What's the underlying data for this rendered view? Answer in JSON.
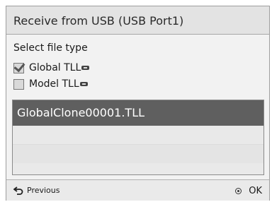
{
  "dialog": {
    "title": "Receive from USB (USB Port1)",
    "section_label": "Select file type"
  },
  "options": [
    {
      "label": "Global TLL",
      "checked": true,
      "icon": "usb-icon"
    },
    {
      "label": "Model TLL",
      "checked": false,
      "icon": "usb-icon"
    }
  ],
  "filelist": {
    "items": [
      "GlobalClone00001.TLL",
      "",
      "",
      ""
    ],
    "selected_index": 0
  },
  "footer": {
    "previous_label": "Previous",
    "previous_icon": "back-arrow-icon",
    "ok_label": "OK",
    "ok_icon": "ok-button-icon"
  },
  "colors": {
    "selected_row": "#5f5f5f",
    "titlebar": "#e3e3e3",
    "background": "#f2f2f2"
  }
}
